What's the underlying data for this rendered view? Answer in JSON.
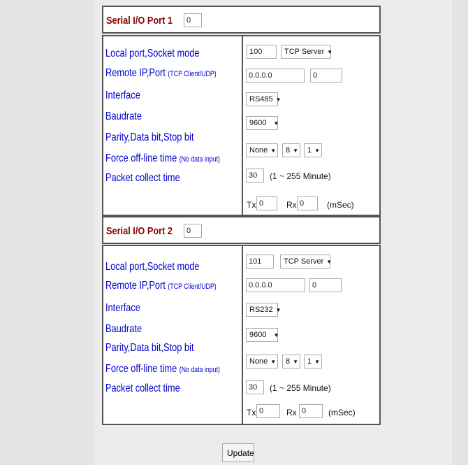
{
  "ports": [
    {
      "title": "Serial I/O Port 1",
      "port_index_value": "0",
      "labels": {
        "local": "Local port,Socket mode",
        "remote": "Remote IP,Port",
        "remote_hint": "(TCP Client/UDP)",
        "interface": "Interface",
        "baudrate": "Baudrate",
        "parity": "Parity,Data bit,Stop bit",
        "force": "Force off-line time",
        "force_hint": "(No data input)",
        "packet": "Packet collect time"
      },
      "local_port": "100",
      "socket_mode": "TCP Server",
      "remote_ip": "0.0.0.0",
      "remote_port": "0",
      "interface": "RS485",
      "baudrate": "9600",
      "parity": "None",
      "data_bit": "8",
      "stop_bit": "1",
      "force_time": "30",
      "force_range": "(1 ~ 255 Minute)",
      "tx_label": "Tx",
      "tx": "0",
      "rx_label": "Rx",
      "rx": "0",
      "unit": "(mSec)"
    },
    {
      "title": "Serial I/O Port 2",
      "port_index_value": "0",
      "labels": {
        "local": "Local port,Socket mode",
        "remote": "Remote IP,Port",
        "remote_hint": "(TCP Client/UDP)",
        "interface": "Interface",
        "baudrate": "Baudrate",
        "parity": "Parity,Data bit,Stop bit",
        "force": "Force off-line time",
        "force_hint": "(No data input)",
        "packet": "Packet collect time"
      },
      "local_port": "101",
      "socket_mode": "TCP Server",
      "remote_ip": "0.0.0.0",
      "remote_port": "0",
      "interface": "RS232",
      "baudrate": "9600",
      "parity": "None",
      "data_bit": "8",
      "stop_bit": "1",
      "force_time": "30",
      "force_range": "(1 ~ 255 Minute)",
      "tx_label": "Tx",
      "tx": "0",
      "rx_label": "Rx",
      "rx": "0",
      "unit": "(mSec)"
    }
  ],
  "update_label": "Update",
  "icons": {
    "dropdown": "chevron-down-icon"
  }
}
